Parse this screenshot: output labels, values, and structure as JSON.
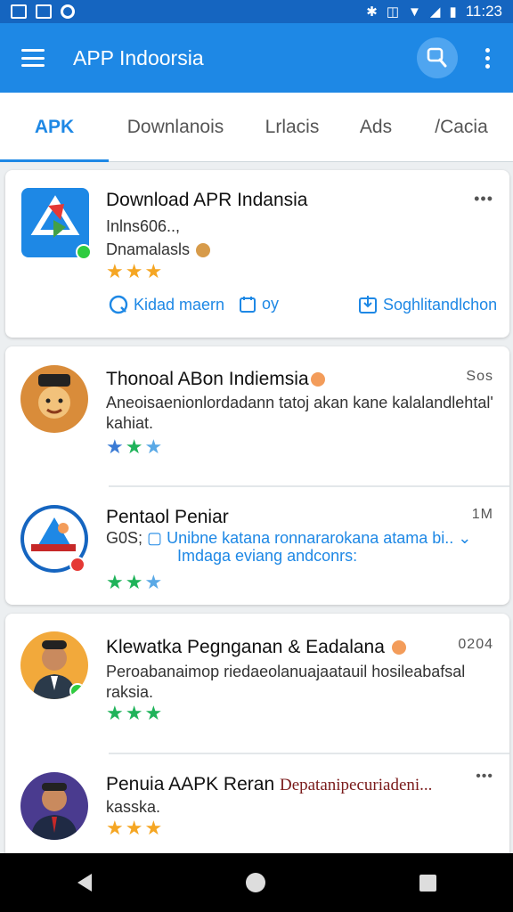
{
  "status_bar": {
    "time": "11:23"
  },
  "app_bar": {
    "title": "APP Indoorsia"
  },
  "tabs": [
    {
      "label": "APK"
    },
    {
      "label": "Downlanois"
    },
    {
      "label": "Lrlacis"
    },
    {
      "label": "Ads"
    },
    {
      "label": "/Cacia"
    }
  ],
  "featured": {
    "name": "Download APR Indansia",
    "line1": "Inlns606..,",
    "line2": "Dnamalasls",
    "rating": 3,
    "more": "•••",
    "action_left": "Kidad maern",
    "action_mid": "oy",
    "action_right": "Soghlitandlchon"
  },
  "list_one": [
    {
      "name": "Thonoal ABon Indiemsia",
      "corner": "Sos",
      "desc1": "Aneoisaenionlordadann tatoj akan kane kalalandlehtal'",
      "desc2": "kahiat.",
      "rating": 3
    },
    {
      "name": "Pentaol Peniar",
      "corner": "1M",
      "desc_prefix": "G0S;",
      "desc1": "Unibne katana ronnararokana atama bi.. ⌄",
      "desc2": "Imdaga eviang andconrs:",
      "rating": 3
    }
  ],
  "list_two": [
    {
      "name": "Klewatka Pegnganan & Eadalana",
      "corner": "0204",
      "desc1": "Peroabanaimop riedaeolanuajaatauil hosileabafsal",
      "desc2": "raksia.",
      "rating": 3
    },
    {
      "name": "Penuia AAPK Reran",
      "name_extra": "Depatanipecuriadeni...",
      "corner": "•••",
      "desc1": "kasska.",
      "rating": 3
    }
  ],
  "colors": {
    "primary": "#1e88e5",
    "status_bar": "#1565c0",
    "star_orange": "#f5a623",
    "star_blue": "#3a7bd5",
    "star_green": "#1fb35a"
  }
}
